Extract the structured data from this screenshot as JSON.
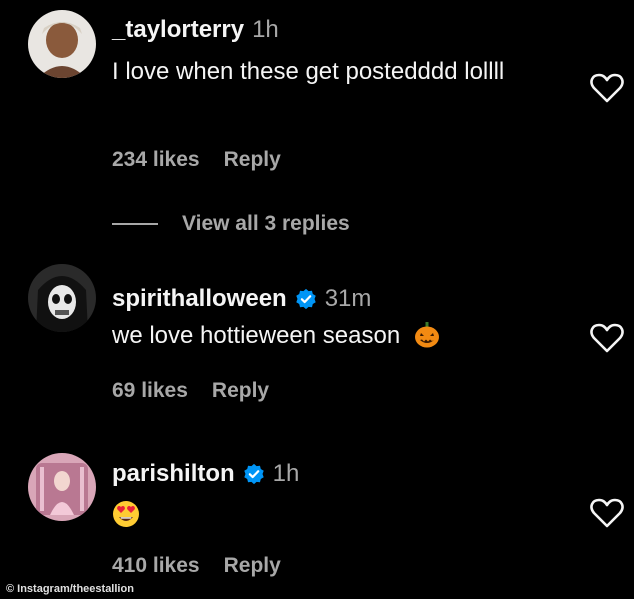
{
  "comments": [
    {
      "username": "_taylorterry",
      "time": "1h",
      "text": "I love when these get postedddd lollll",
      "likes": "234 likes",
      "reply_label": "Reply",
      "verified": false,
      "avatar_icon": "person-avatar"
    },
    {
      "username": "spirithalloween",
      "time": "31m",
      "text": "we love hottieween season",
      "text_emoji": "jack-o-lantern-icon",
      "likes": "69 likes",
      "reply_label": "Reply",
      "verified": true,
      "avatar_icon": "skull-reaper-avatar"
    },
    {
      "username": "parishilton",
      "time": "1h",
      "text_emoji": "heart-eyes-emoji",
      "likes": "410 likes",
      "reply_label": "Reply",
      "verified": true,
      "avatar_icon": "pink-avatar"
    }
  ],
  "view_replies_label": "View all 3 replies",
  "watermark": "© Instagram/theestallion",
  "colors": {
    "background": "#000000",
    "text": "#f5f5f5",
    "secondary": "#a8a8a8",
    "verified": "#0095f6"
  }
}
